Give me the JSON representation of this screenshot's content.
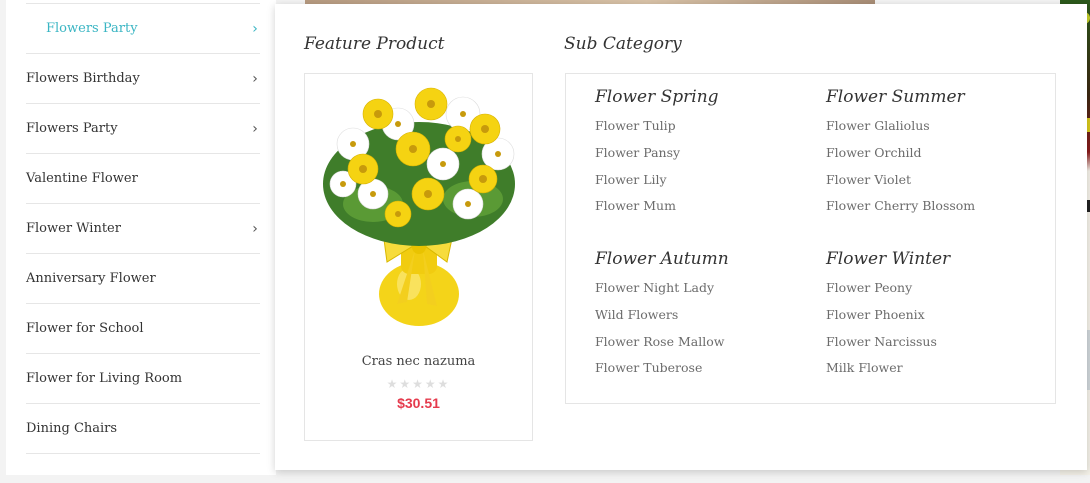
{
  "sidebar": {
    "items": [
      {
        "label": "Flowers Party",
        "has_arrow": true,
        "sub": true
      },
      {
        "label": "Flowers Birthday",
        "has_arrow": true
      },
      {
        "label": "Flowers Party",
        "has_arrow": true
      },
      {
        "label": "Valentine Flower",
        "has_arrow": false
      },
      {
        "label": "Flower Winter",
        "has_arrow": true
      },
      {
        "label": "Anniversary Flower",
        "has_arrow": false
      },
      {
        "label": "Flower for School",
        "has_arrow": false
      },
      {
        "label": "Flower for Living Room",
        "has_arrow": false
      },
      {
        "label": "Dining Chairs",
        "has_arrow": false
      }
    ],
    "arrow_glyph": "›"
  },
  "dropdown": {
    "feature_title": "Feature Product",
    "sub_title": "Sub Category",
    "product": {
      "name": "Cras nec nazuma",
      "rating": 0,
      "max_rating": 5,
      "price": "$30.51",
      "image_icon": "flower-bouquet-image"
    },
    "categories": [
      {
        "title": "Flower Spring",
        "items": [
          "Flower Tulip",
          "Flower Pansy",
          "Flower Lily",
          "Flower Mum"
        ]
      },
      {
        "title": "Flower Summer",
        "items": [
          "Flower Glaliolus",
          "Flower Orchild",
          "Flower Violet",
          "Flower Cherry Blossom"
        ]
      },
      {
        "title": "Flower Autumn",
        "items": [
          "Flower Night Lady",
          "Wild Flowers",
          "Flower Rose Mallow",
          "Flower Tuberose"
        ]
      },
      {
        "title": "Flower Winter",
        "items": [
          "Flower Peony",
          "Flower Phoenix",
          "Flower Narcissus",
          "Milk Flower"
        ]
      }
    ]
  },
  "colors": {
    "accent": "#3ab5c3",
    "price": "#e53b4d",
    "star_empty": "#dedede"
  }
}
